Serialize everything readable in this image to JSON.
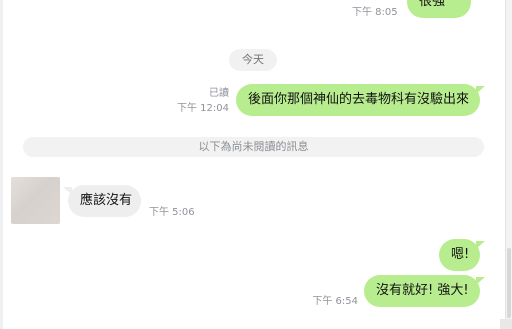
{
  "messages": {
    "top_partial": {
      "text": "很強",
      "time": "下午 8:05"
    },
    "date_separator": "今天",
    "question": {
      "read_label": "已讀",
      "time": "下午 12:04",
      "text": "後面你那個神仙的去毒物科有沒驗出來"
    },
    "unread_divider": "以下為尚未閱讀的訊息",
    "reply": {
      "text": "應該沒有",
      "time": "下午 5:06"
    },
    "response_1": {
      "text": "嗯!"
    },
    "response_2": {
      "text": "沒有就好! 強大!",
      "time": "下午 6:54"
    }
  },
  "colors": {
    "outgoing_bubble": "#b8ed8f",
    "incoming_bubble": "#eeeeee",
    "meta_text": "#8f9399"
  }
}
